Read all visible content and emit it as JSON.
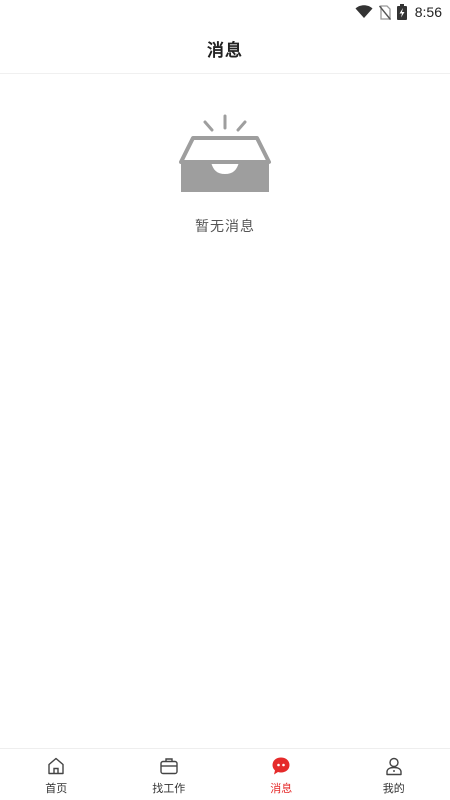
{
  "status_bar": {
    "time": "8:56",
    "icons": [
      "wifi-icon",
      "no-sim-icon",
      "battery-charging-icon"
    ]
  },
  "header": {
    "title": "消息"
  },
  "empty_state": {
    "icon": "empty-inbox-icon",
    "message": "暂无消息"
  },
  "tabbar": {
    "items": [
      {
        "label": "首页",
        "icon": "home-icon",
        "active": false
      },
      {
        "label": "找工作",
        "icon": "briefcase-icon",
        "active": false
      },
      {
        "label": "消息",
        "icon": "chat-icon",
        "active": true
      },
      {
        "label": "我的",
        "icon": "user-icon",
        "active": false
      }
    ],
    "active_color": "#e52a2a"
  }
}
